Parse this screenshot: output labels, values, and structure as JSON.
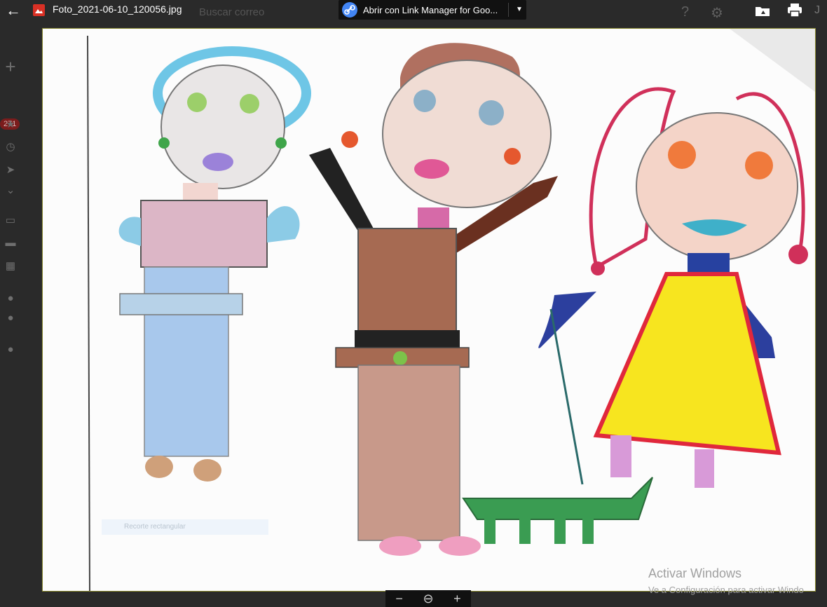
{
  "viewer": {
    "file_name": "Foto_2021-06-10_120056.jpg",
    "open_with_label": "Abrir con Link Manager for Goo...",
    "back_icon": "arrow-left-icon",
    "file_type_icon": "image-file-icon",
    "open_with_icon": "link-icon",
    "add_to_drive_icon": "add-to-drive-icon",
    "print_icon": "printer-icon"
  },
  "gmail_bg": {
    "search_placeholder": "Buscar correo",
    "unread_count": "271",
    "brand_fragment": "J"
  },
  "overlay": {
    "snip_label": "Recorte rectangular"
  },
  "windows_watermark": {
    "title": "Activar Windows",
    "subtitle": "Ve a Configuración para activar Windo"
  },
  "zoom": {
    "out_label": "−",
    "reset_label": "⊖",
    "in_label": "+"
  },
  "colors": {
    "file_icon": "#d93025",
    "link_icon": "#4285f4",
    "badge": "#7b1c1c"
  }
}
